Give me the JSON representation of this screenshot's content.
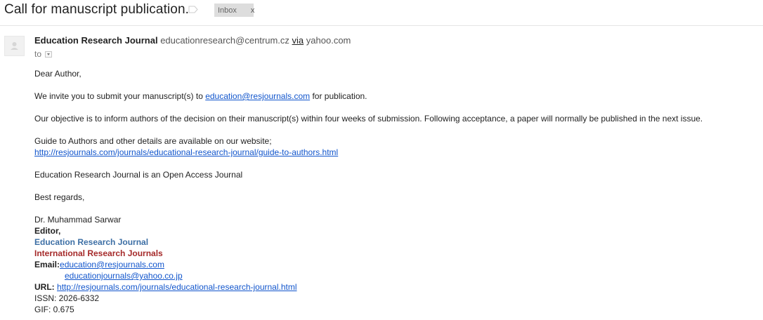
{
  "header": {
    "subject": "Call for manuscript publication.",
    "label_chip": "Inbox",
    "label_chip_close": "x"
  },
  "sender": {
    "name": "Education Research Journal",
    "email": "educationresearch@centrum.cz",
    "via": "via",
    "via_domain": "yahoo.com",
    "to_label": "to"
  },
  "body": {
    "greeting": "Dear Author,",
    "invite_prefix": "We invite you to submit your manuscript(s) to ",
    "invite_email": "education@resjournals.com",
    "invite_suffix": " for publication.",
    "objective": "Our objective is to inform authors of the decision on their manuscript(s) within four weeks of submission. Following acceptance, a paper will normally be published in the next issue.",
    "guide_text": "Guide to Authors and other details are available on our website;",
    "guide_link": "http://resjournals.com/journals/educational-research-journal/guide-to-authors.html",
    "open_access": "Education Research Journal is an Open Access Journal",
    "regards": "Best regards,"
  },
  "signature": {
    "name": "Dr. Muhammad Sarwar",
    "title": "Editor,",
    "journal": "Education Research Journal",
    "publisher": "International Research Journals",
    "email_label": "Email:",
    "email_1": "education@resjournals.com",
    "email_2": "educationjournals@yahoo.co.jp",
    "url_label": "URL:",
    "url": "http://resjournals.com/journals/educational-research-journal.html",
    "issn": "ISSN: 2026-6332",
    "gif": "GIF: 0.675"
  },
  "colors": {
    "link": "#1155cc",
    "journal_blue": "#3d6fa5",
    "publisher_red": "#a52a2a",
    "chip_bg": "#dddddd"
  }
}
